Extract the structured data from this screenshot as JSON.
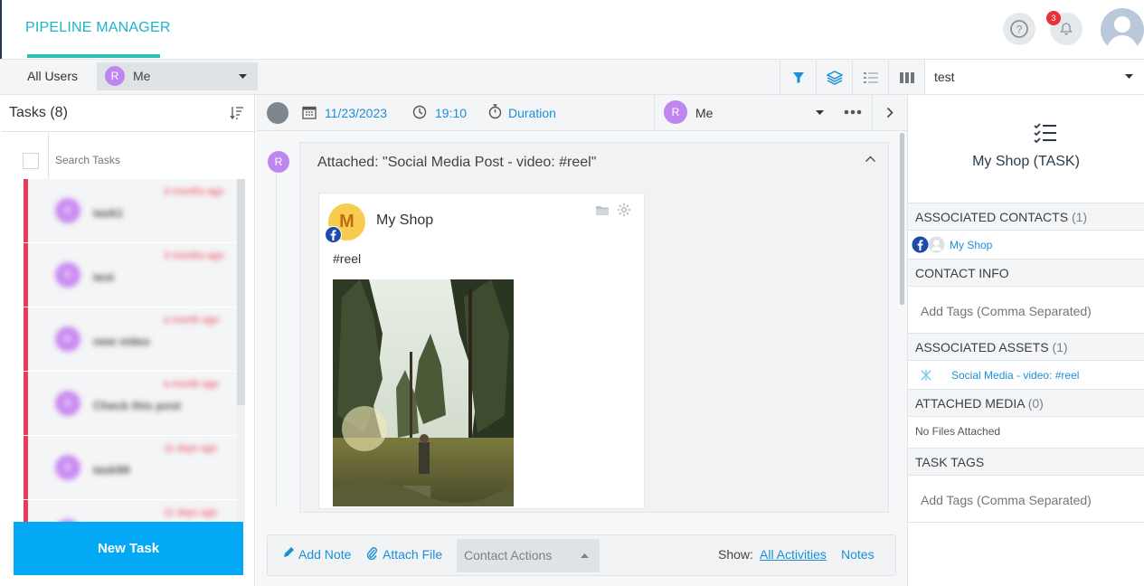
{
  "header": {
    "brand": "PIPELINE MANAGER",
    "help_icon": "question-circle-icon",
    "notifications_count": "3",
    "notifications_icon": "bell-icon"
  },
  "toolbar": {
    "all_users_label": "All Users",
    "user_avatar_letter": "R",
    "user_label": "Me",
    "icons": [
      "filter-icon",
      "layers-icon",
      "list-icon",
      "columns-icon"
    ],
    "pipeline_select_value": "test"
  },
  "tasks_panel": {
    "title": "Tasks (8)",
    "search_placeholder": "Search Tasks",
    "new_task_label": "New Task",
    "items": [
      {
        "avatar": "R",
        "name": "task1",
        "time": "3 months ago"
      },
      {
        "avatar": "R",
        "name": "test",
        "time": "3 months ago"
      },
      {
        "avatar": "R",
        "name": "new video",
        "time": "a month ago"
      },
      {
        "avatar": "R",
        "name": "Check this post",
        "time": "a month ago"
      },
      {
        "avatar": "R",
        "name": "task99",
        "time": "11 days ago"
      },
      {
        "avatar": "R",
        "name": "",
        "time": "11 days ago"
      }
    ]
  },
  "task_header": {
    "date": "11/23/2023",
    "time": "19:10",
    "duration_label": "Duration",
    "assignee_avatar": "R",
    "assignee": "Me"
  },
  "activity": {
    "avatar_letter": "R",
    "attached_title": "Attached: \"Social Media Post - video: #reel\"",
    "post": {
      "page_avatar_letter": "M",
      "page_name": "My Shop",
      "text": "#reel"
    }
  },
  "bottom_bar": {
    "add_note_label": "Add Note",
    "attach_file_label": "Attach File",
    "contact_actions_label": "Contact Actions",
    "show_label": "Show:",
    "all_activities_label": "All Activities",
    "notes_label": "Notes"
  },
  "right_panel": {
    "title": "My Shop (TASK)",
    "associated_contacts_label": "ASSOCIATED CONTACTS",
    "associated_contacts_count": "(1)",
    "contact_name": "My Shop",
    "contact_info_label": "CONTACT INFO",
    "tags_placeholder": "Add Tags (Comma Separated)",
    "associated_assets_label": "ASSOCIATED ASSETS",
    "associated_assets_count": "(1)",
    "asset_name": "Social Media - video: #reel",
    "attached_media_label": "ATTACHED MEDIA",
    "attached_media_count": "(0)",
    "no_files_label": "No Files Attached",
    "task_tags_label": "TASK TAGS",
    "task_tags_placeholder": "Add Tags (Comma Separated)"
  },
  "colors": {
    "brand": "#1db4c8",
    "accent_blue": "#1a8fd8",
    "new_task": "#03a9f4",
    "task_border": "#ea3b57",
    "avatar_purple": "#c086f0"
  }
}
